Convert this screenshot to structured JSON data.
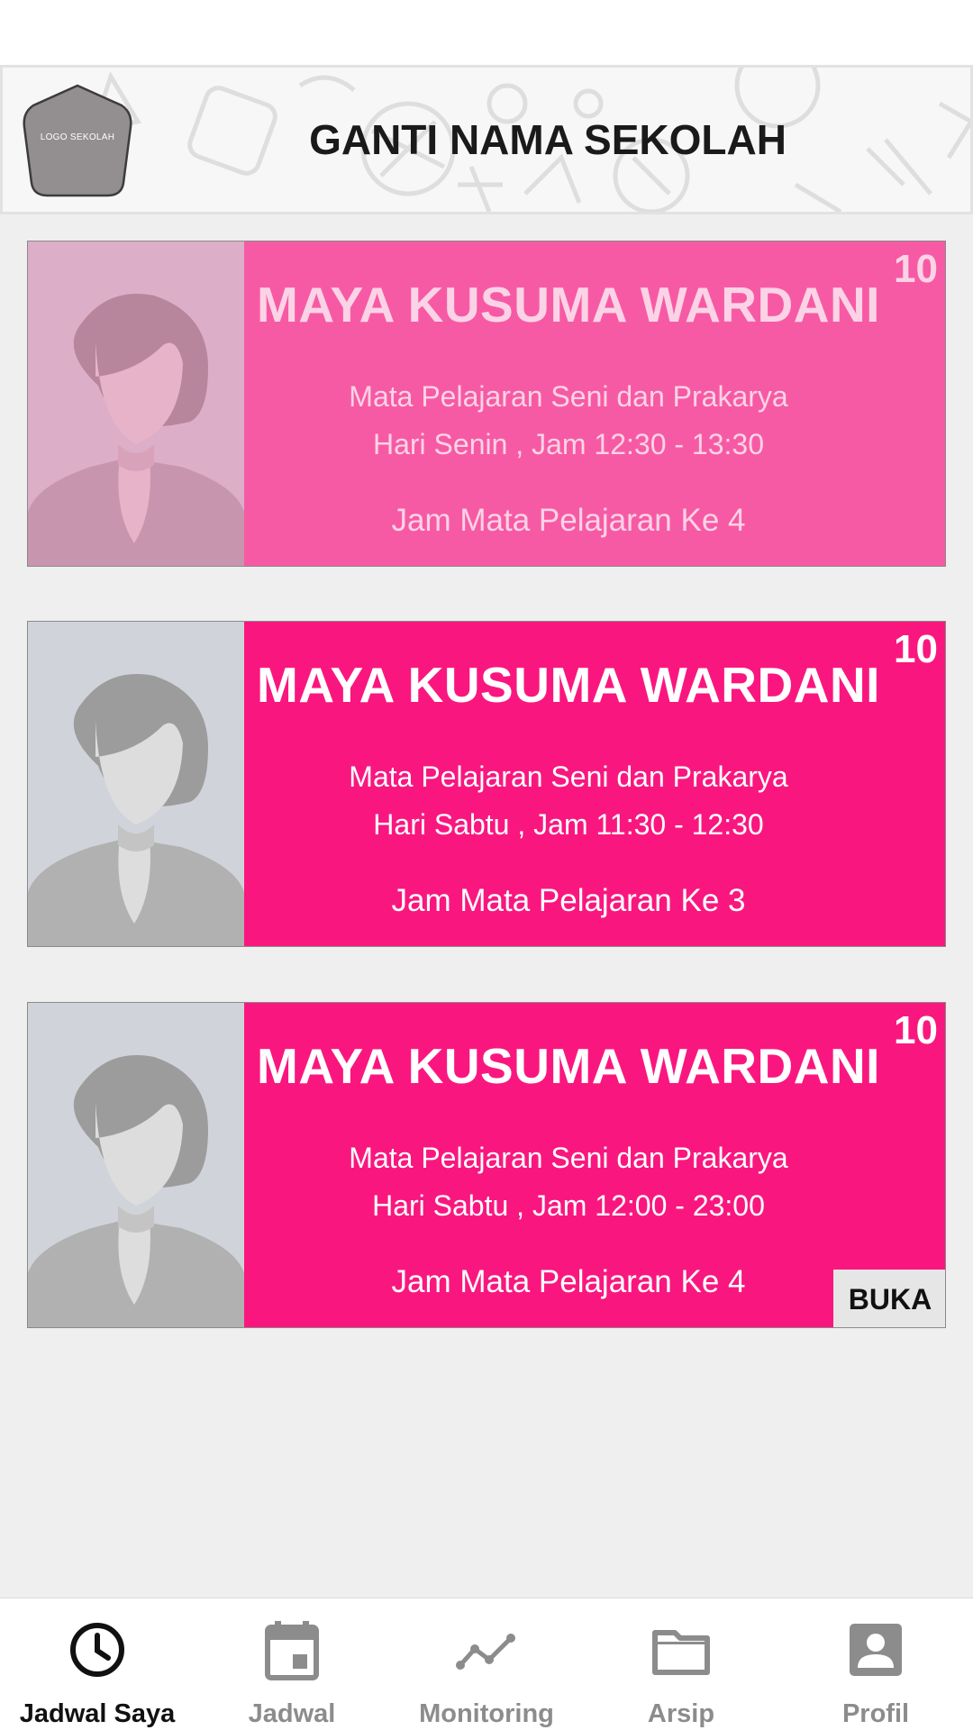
{
  "header": {
    "logo_text": "LOGO SEKOLAH",
    "school_name": "GANTI NAMA SEKOLAH"
  },
  "cards": [
    {
      "count": "10",
      "teacher": "MAYA KUSUMA WARDANI",
      "subject": "Mata Pelajaran Seni dan Prakarya",
      "schedule": "Hari Senin , Jam 12:30 - 13:30",
      "period": "Jam Mata Pelajaran Ke 4",
      "state": "faded"
    },
    {
      "count": "10",
      "teacher": "MAYA KUSUMA WARDANI",
      "subject": "Mata Pelajaran Seni dan Prakarya",
      "schedule": "Hari Sabtu , Jam 11:30 - 12:30",
      "period": "Jam Mata Pelajaran Ke 3",
      "state": "normal"
    },
    {
      "count": "10",
      "teacher": "MAYA KUSUMA WARDANI",
      "subject": "Mata Pelajaran Seni dan Prakarya",
      "schedule": "Hari Sabtu , Jam 12:00 - 23:00",
      "period": "Jam Mata Pelajaran Ke 4",
      "state": "normal",
      "button_label": "BUKA"
    }
  ],
  "nav": {
    "items": [
      {
        "label": "Jadwal Saya",
        "icon": "clock-icon",
        "active": true
      },
      {
        "label": "Jadwal",
        "icon": "calendar-icon",
        "active": false
      },
      {
        "label": "Monitoring",
        "icon": "trend-line-icon",
        "active": false
      },
      {
        "label": "Arsip",
        "icon": "folder-icon",
        "active": false
      },
      {
        "label": "Profil",
        "icon": "account-box-icon",
        "active": false
      }
    ]
  },
  "colors": {
    "card_active": "#f9177f",
    "card_faded": "#f75aa4",
    "nav_active": "#111111",
    "nav_inactive": "#8c8c8c"
  }
}
